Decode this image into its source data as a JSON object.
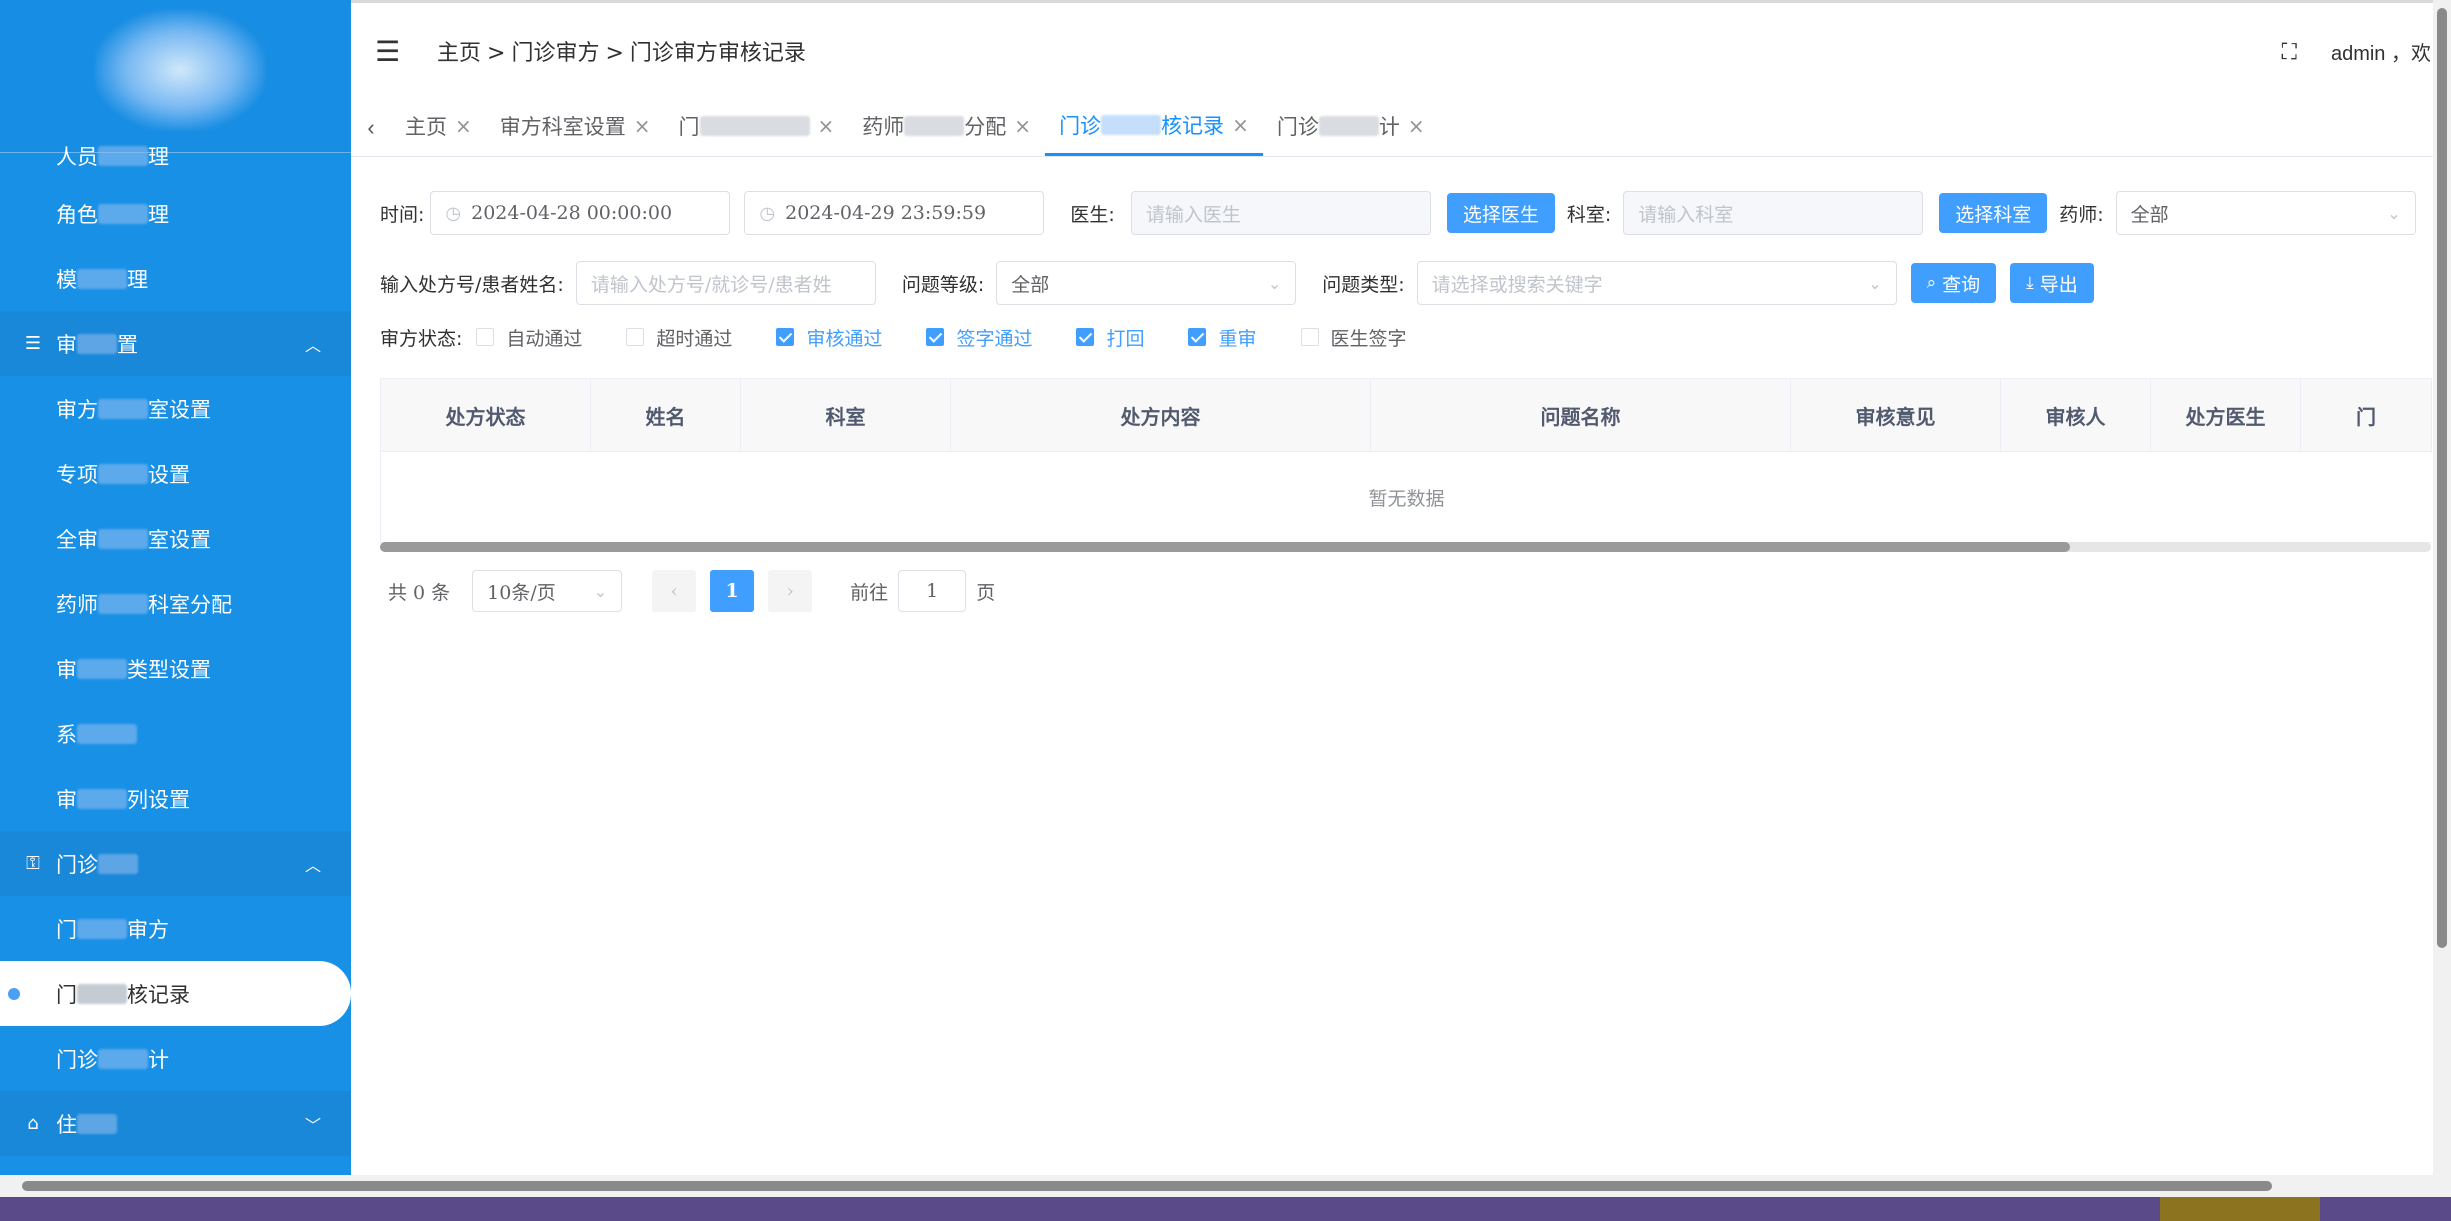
{
  "sidebar": {
    "items": [
      {
        "label_start": "人员",
        "label_end": "理",
        "type": "item",
        "partial": true
      },
      {
        "label_start": "角色",
        "label_end": "理",
        "type": "item"
      },
      {
        "label_start": "模",
        "label_end": "理",
        "type": "item"
      },
      {
        "label_start": "审",
        "label_end": "置",
        "type": "group",
        "icon": "sliders-icon",
        "expanded": true
      },
      {
        "label_start": "审方",
        "label_end": "室设置",
        "type": "item"
      },
      {
        "label_start": "专项",
        "label_end": "设置",
        "type": "item"
      },
      {
        "label_start": "全审",
        "label_end": "室设置",
        "type": "item"
      },
      {
        "label_start": "药师",
        "label_end": "科室分配",
        "type": "item"
      },
      {
        "label_start": "审",
        "label_end": "类型设置",
        "type": "item"
      },
      {
        "label_start": "系",
        "label_end": "",
        "type": "item"
      },
      {
        "label_start": "审",
        "label_end": "列设置",
        "type": "item"
      },
      {
        "label_start": "门诊",
        "label_end": "",
        "type": "group",
        "icon": "lock-icon",
        "expanded": true
      },
      {
        "label_start": "门",
        "label_end": "审方",
        "type": "item"
      },
      {
        "label_start": "门",
        "label_end": "核记录",
        "type": "item",
        "active": true
      },
      {
        "label_start": "门诊",
        "label_end": "计",
        "type": "item"
      },
      {
        "label_start": "住",
        "label_end": "",
        "type": "group",
        "icon": "bed-icon",
        "expanded": false
      }
    ]
  },
  "header": {
    "breadcrumb": [
      "主页",
      "门诊审方",
      "门诊审方审核记录"
    ],
    "breadcrumb_sep": ">",
    "user": "admin",
    "greeting": "，欢"
  },
  "tabs": [
    {
      "label_start": "主页",
      "label_end": "",
      "active": false
    },
    {
      "label_start": "审方科室设置",
      "label_end": "",
      "active": false
    },
    {
      "label_start": "门",
      "label_end": "",
      "active": false
    },
    {
      "label_start": "药师",
      "label_end": "分配",
      "active": false
    },
    {
      "label_start": "门诊",
      "label_end": "核记录",
      "active": true
    },
    {
      "label_start": "门诊",
      "label_end": "计",
      "active": false
    }
  ],
  "filters": {
    "time_label": "时间:",
    "start_time": "2024-04-28 00:00:00",
    "end_time": "2024-04-29 23:59:59",
    "doctor_label": "医生:",
    "doctor_placeholder": "请输入医生",
    "select_doctor_btn": "选择医生",
    "dept_label": "科室:",
    "dept_placeholder": "请输入科室",
    "select_dept_btn": "选择科室",
    "pharmacist_label": "药师:",
    "pharmacist_value": "全部",
    "rx_label": "输入处方号/患者姓名:",
    "rx_placeholder": "请输入处方号/就诊号/患者姓",
    "level_label": "问题等级:",
    "level_value": "全部",
    "type_label": "问题类型:",
    "type_placeholder": "请选择或搜索关键字",
    "query_btn": "查询",
    "export_btn": "导出",
    "status_label": "审方状态:",
    "statuses": [
      {
        "label": "自动通过",
        "checked": false
      },
      {
        "label": "超时通过",
        "checked": false
      },
      {
        "label": "审核通过",
        "checked": true
      },
      {
        "label": "签字通过",
        "checked": true
      },
      {
        "label": "打回",
        "checked": true
      },
      {
        "label": "重审",
        "checked": true
      },
      {
        "label": "医生签字",
        "checked": false
      }
    ]
  },
  "table": {
    "columns": [
      "处方状态",
      "姓名",
      "科室",
      "处方内容",
      "问题名称",
      "审核意见",
      "审核人",
      "处方医生",
      "门"
    ],
    "empty_text": "暂无数据"
  },
  "pagination": {
    "total_text": "共 0 条",
    "page_size": "10条/页",
    "current_page": "1",
    "goto_prefix": "前往",
    "goto_value": "1",
    "goto_suffix": "页"
  }
}
